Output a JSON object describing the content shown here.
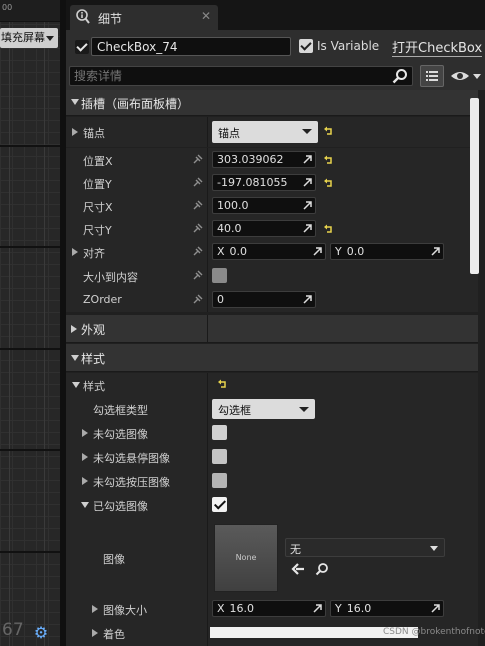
{
  "viewport": {
    "ruler_label": "00",
    "fill_screen": "填充屏幕",
    "zoom_text": "67",
    "settings_icon": "gear-icon"
  },
  "tab": {
    "label": "细节",
    "icon": "info-icon",
    "close": "✕"
  },
  "widget": {
    "name": "CheckBox_74",
    "is_variable": "Is Variable",
    "open_link": "打开CheckBox"
  },
  "search": {
    "placeholder": "搜索详情"
  },
  "sections": {
    "slot": "插槽（画布面板槽）",
    "appearance": "外观",
    "style": "样式"
  },
  "slot_props": {
    "anchors": {
      "label": "锚点",
      "value": "锚点"
    },
    "pos_x": {
      "label": "位置X",
      "value": "303.039062"
    },
    "pos_y": {
      "label": "位置Y",
      "value": "-197.081055"
    },
    "size_x": {
      "label": "尺寸X",
      "value": "100.0"
    },
    "size_y": {
      "label": "尺寸Y",
      "value": "40.0"
    },
    "alignment": {
      "label": "对齐",
      "x_label": "X",
      "x": "0.0",
      "y_label": "Y",
      "y": "0.0"
    },
    "auto_size": {
      "label": "大小到内容"
    },
    "zorder": {
      "label": "ZOrder",
      "value": "0"
    }
  },
  "style_props": {
    "style_group": "样式",
    "checkbox_type": {
      "label": "勾选框类型",
      "value": "勾选框"
    },
    "unchecked_image": "未勾选图像",
    "unchecked_hover": "未勾选悬停图像",
    "unchecked_pressed": "未勾选按压图像",
    "checked_image": "已勾选图像",
    "image": {
      "label": "图像",
      "thumb": "None",
      "asset": "无"
    },
    "image_size": {
      "label": "图像大小",
      "x_label": "X",
      "x": "16.0",
      "y_label": "Y",
      "y": "16.0"
    },
    "tint": {
      "label": "着色"
    }
  },
  "watermark": "CSDN @brokenthofnotes"
}
